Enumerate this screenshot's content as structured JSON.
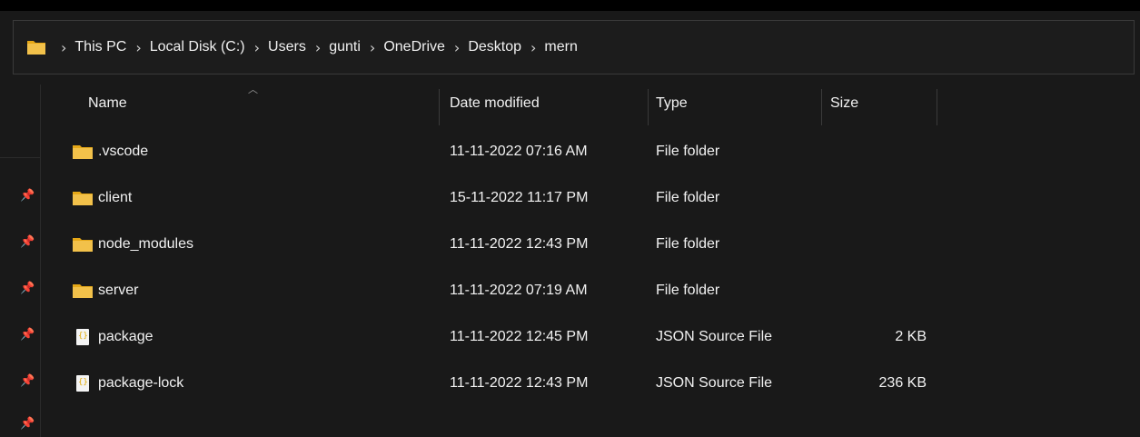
{
  "colors": {
    "background": "#191919",
    "folder": "#f2c14a",
    "folder_dark": "#e6a817",
    "text": "#f2f2f2"
  },
  "address_bar": {
    "icon": "folder-icon",
    "crumbs": [
      "This PC",
      "Local Disk (C:)",
      "Users",
      "gunti",
      "OneDrive",
      "Desktop",
      "mern"
    ]
  },
  "columns": {
    "name": "Name",
    "date": "Date modified",
    "type": "Type",
    "size": "Size"
  },
  "rows": [
    {
      "name": ".vscode",
      "date": "11-11-2022 07:16 AM",
      "type": "File folder",
      "size": "",
      "icon": "folder-icon"
    },
    {
      "name": "client",
      "date": "15-11-2022 11:17 PM",
      "type": "File folder",
      "size": "",
      "icon": "folder-icon"
    },
    {
      "name": "node_modules",
      "date": "11-11-2022 12:43 PM",
      "type": "File folder",
      "size": "",
      "icon": "folder-icon"
    },
    {
      "name": "server",
      "date": "11-11-2022 07:19 AM",
      "type": "File folder",
      "size": "",
      "icon": "folder-icon"
    },
    {
      "name": "package",
      "date": "11-11-2022 12:45 PM",
      "type": "JSON Source File",
      "size": "2 KB",
      "icon": "json-file-icon"
    },
    {
      "name": "package-lock",
      "date": "11-11-2022 12:43 PM",
      "type": "JSON Source File",
      "size": "236 KB",
      "icon": "json-file-icon"
    }
  ],
  "pins": [
    "pin-icon",
    "pin-icon",
    "pin-icon",
    "pin-icon",
    "pin-icon",
    "pin-icon"
  ]
}
